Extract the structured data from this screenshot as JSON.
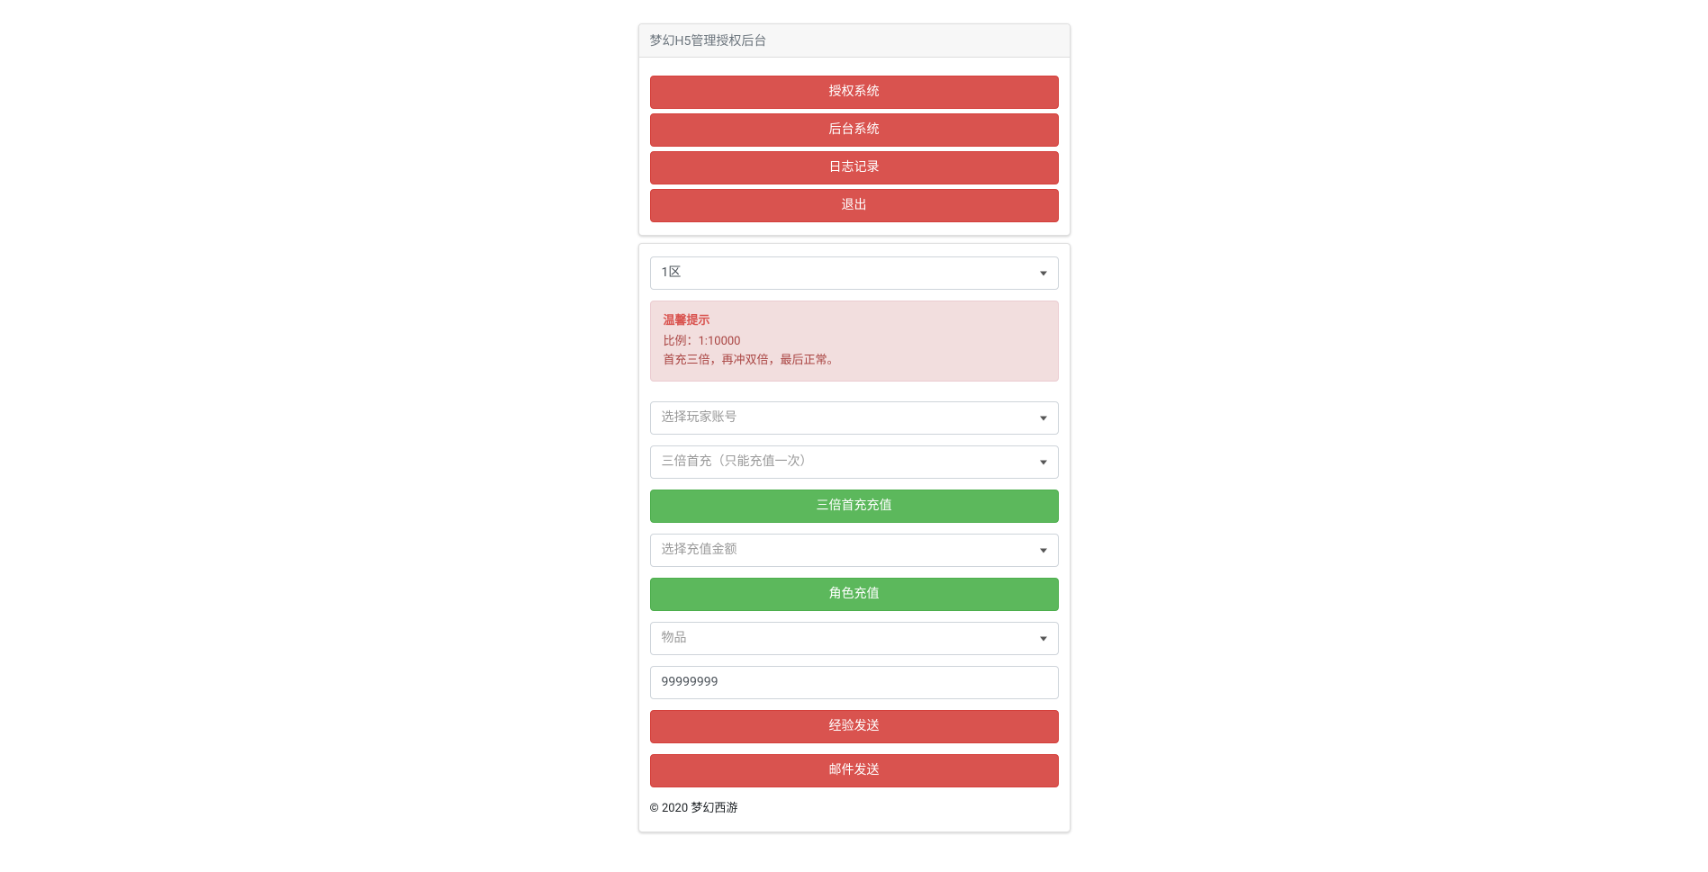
{
  "header": {
    "title": "梦幻H5管理授权后台"
  },
  "nav": {
    "auth_system": "授权系统",
    "backend_system": "后台系统",
    "log_records": "日志记录",
    "logout": "退出"
  },
  "main": {
    "zone_select": "1区",
    "alert": {
      "title": "温馨提示",
      "line1": "比例：1:10000",
      "line2": "首充三倍，再冲双倍，最后正常。"
    },
    "player_select_placeholder": "选择玩家账号",
    "first_charge_select": "三倍首充（只能充值一次）",
    "triple_recharge_btn": "三倍首充充值",
    "amount_select_placeholder": "选择充值金额",
    "role_recharge_btn": "角色充值",
    "item_select_placeholder": "物品",
    "quantity_value": "99999999",
    "exp_send_btn": "经验发送",
    "mail_send_btn": "邮件发送"
  },
  "footer": {
    "copyright": "© 2020 梦幻西游"
  }
}
